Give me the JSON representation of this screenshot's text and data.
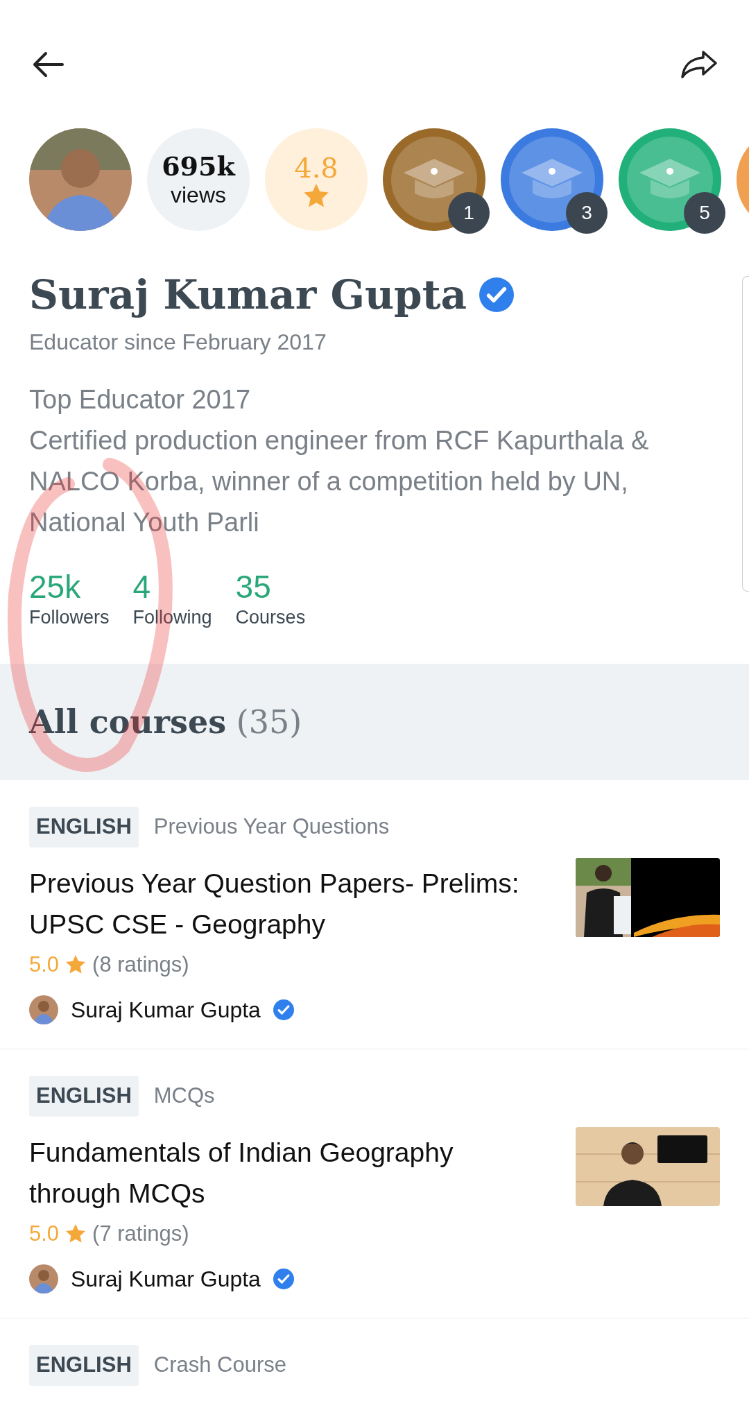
{
  "stats_row": {
    "views": {
      "value": "695k",
      "label": "views"
    },
    "rating": {
      "value": "4.8"
    },
    "badges": [
      {
        "count": "1",
        "color": "#9a6a2a"
      },
      {
        "count": "3",
        "color": "#3b7be0"
      },
      {
        "count": "5",
        "color": "#22b07a"
      }
    ]
  },
  "profile": {
    "name": "Suraj Kumar Gupta",
    "verified": true,
    "since": "Educator since February 2017",
    "bio": [
      "Top Educator 2017",
      "Certified production engineer from RCF Kapurthala & NALCO Korba, winner of a competition held by UN, National Youth Parli"
    ],
    "counts": [
      {
        "value": "25k",
        "label": "Followers"
      },
      {
        "value": "4",
        "label": "Following"
      },
      {
        "value": "35",
        "label": "Courses"
      }
    ]
  },
  "section": {
    "title": "All courses",
    "count": "(35)"
  },
  "courses": [
    {
      "language": "ENGLISH",
      "category": "Previous Year Questions",
      "title": "Previous Year Question Papers- Prelims: UPSC CSE - Geography",
      "rating": "5.0",
      "ratings_count": "(8 ratings)",
      "author": "Suraj Kumar Gupta",
      "verified": true
    },
    {
      "language": "ENGLISH",
      "category": "MCQs",
      "title": "Fundamentals of Indian Geography through MCQs",
      "rating": "5.0",
      "ratings_count": "(7 ratings)",
      "author": "Suraj Kumar Gupta",
      "verified": true
    },
    {
      "language": "ENGLISH",
      "category": "Crash Course"
    }
  ]
}
